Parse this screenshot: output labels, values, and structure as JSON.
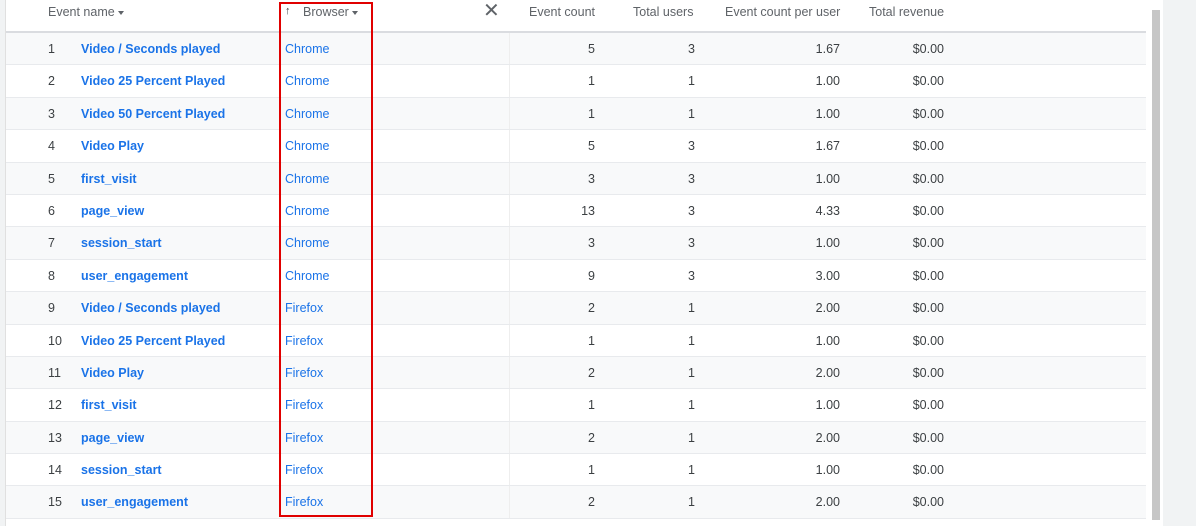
{
  "header": {
    "event_name": "Event name",
    "browser": "Browser",
    "sort_arrow": "↑",
    "close": "✕",
    "event_count": "Event count",
    "total_users": "Total users",
    "event_count_per_user": "Event count per user",
    "total_revenue": "Total revenue"
  },
  "rows": [
    {
      "idx": "1",
      "event": "Video / Seconds played",
      "browser": "Chrome",
      "count": "5",
      "users": "3",
      "per_user": "1.67",
      "revenue": "$0.00"
    },
    {
      "idx": "2",
      "event": "Video 25 Percent Played",
      "browser": "Chrome",
      "count": "1",
      "users": "1",
      "per_user": "1.00",
      "revenue": "$0.00"
    },
    {
      "idx": "3",
      "event": "Video 50 Percent Played",
      "browser": "Chrome",
      "count": "1",
      "users": "1",
      "per_user": "1.00",
      "revenue": "$0.00"
    },
    {
      "idx": "4",
      "event": "Video Play",
      "browser": "Chrome",
      "count": "5",
      "users": "3",
      "per_user": "1.67",
      "revenue": "$0.00"
    },
    {
      "idx": "5",
      "event": "first_visit",
      "browser": "Chrome",
      "count": "3",
      "users": "3",
      "per_user": "1.00",
      "revenue": "$0.00"
    },
    {
      "idx": "6",
      "event": "page_view",
      "browser": "Chrome",
      "count": "13",
      "users": "3",
      "per_user": "4.33",
      "revenue": "$0.00"
    },
    {
      "idx": "7",
      "event": "session_start",
      "browser": "Chrome",
      "count": "3",
      "users": "3",
      "per_user": "1.00",
      "revenue": "$0.00"
    },
    {
      "idx": "8",
      "event": "user_engagement",
      "browser": "Chrome",
      "count": "9",
      "users": "3",
      "per_user": "3.00",
      "revenue": "$0.00"
    },
    {
      "idx": "9",
      "event": "Video / Seconds played",
      "browser": "Firefox",
      "count": "2",
      "users": "1",
      "per_user": "2.00",
      "revenue": "$0.00"
    },
    {
      "idx": "10",
      "event": "Video 25 Percent Played",
      "browser": "Firefox",
      "count": "1",
      "users": "1",
      "per_user": "1.00",
      "revenue": "$0.00"
    },
    {
      "idx": "11",
      "event": "Video Play",
      "browser": "Firefox",
      "count": "2",
      "users": "1",
      "per_user": "2.00",
      "revenue": "$0.00"
    },
    {
      "idx": "12",
      "event": "first_visit",
      "browser": "Firefox",
      "count": "1",
      "users": "1",
      "per_user": "1.00",
      "revenue": "$0.00"
    },
    {
      "idx": "13",
      "event": "page_view",
      "browser": "Firefox",
      "count": "2",
      "users": "1",
      "per_user": "2.00",
      "revenue": "$0.00"
    },
    {
      "idx": "14",
      "event": "session_start",
      "browser": "Firefox",
      "count": "1",
      "users": "1",
      "per_user": "1.00",
      "revenue": "$0.00"
    },
    {
      "idx": "15",
      "event": "user_engagement",
      "browser": "Firefox",
      "count": "2",
      "users": "1",
      "per_user": "2.00",
      "revenue": "$0.00"
    }
  ],
  "colors": {
    "link": "#1a73e8",
    "highlight_border": "#e00000",
    "header_text": "#5f6368"
  }
}
